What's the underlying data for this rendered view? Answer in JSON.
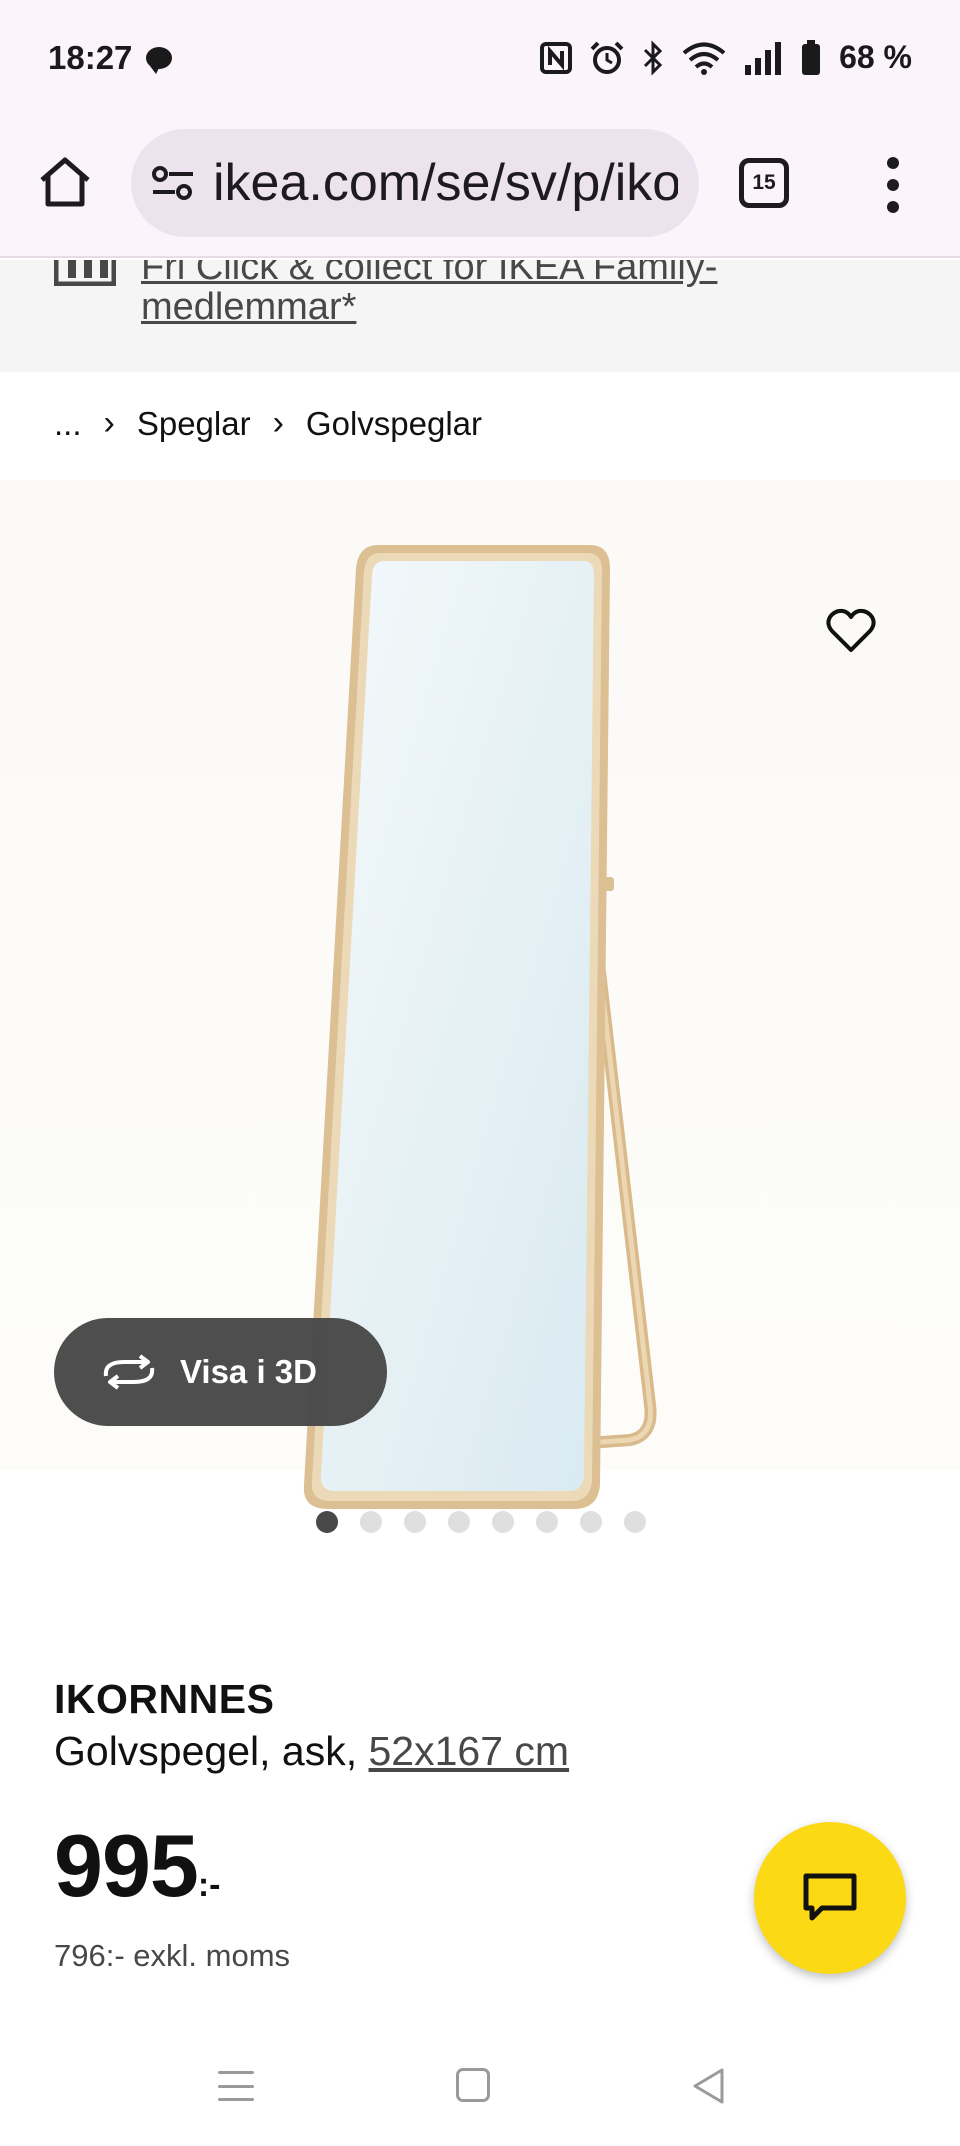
{
  "status_bar": {
    "time": "18:27",
    "battery": "68 %"
  },
  "browser": {
    "url": "ikea.com/se/sv/p/ikornnes",
    "tab_count": "15"
  },
  "promo": {
    "line1": "Fri Click & collect för IKEA Family-",
    "line2": "medlemmar*"
  },
  "breadcrumb": {
    "ellipsis": "...",
    "items": [
      "Speglar",
      "Golvspeglar"
    ]
  },
  "gallery": {
    "view_3d_label": "Visa i 3D",
    "image_count": 8,
    "active_index": 0
  },
  "product": {
    "name": "IKORNNES",
    "description": "Golvspegel, ask, ",
    "size": "52x167 cm",
    "price": "995",
    "price_suffix": ":-",
    "price_ex_vat": "796:- exkl. moms"
  },
  "colors": {
    "brand_yellow": "#fbd914",
    "text_primary": "#111111",
    "text_secondary": "#484848",
    "mirror_frame": "#e0c69a",
    "mirror_glass": "#e4f0f5"
  },
  "icons": {
    "home": "home-icon",
    "site_settings": "tune-icon",
    "tabs": "tabs-icon",
    "menu": "more-vert-icon",
    "favorite": "heart-icon",
    "rotate_3d": "rotate-icon",
    "chat": "chat-icon"
  }
}
